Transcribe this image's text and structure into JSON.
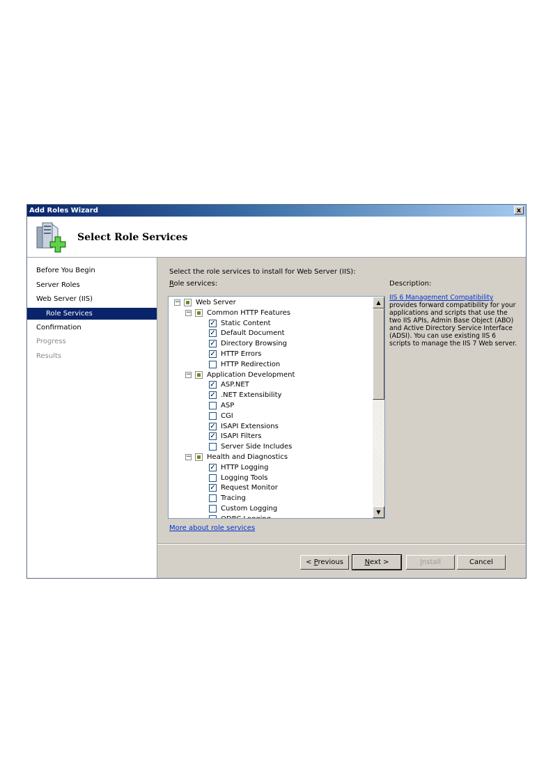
{
  "window": {
    "title": "Add Roles Wizard",
    "close_label": "x",
    "header_title": "Select Role Services"
  },
  "nav": {
    "items": [
      {
        "label": "Before You Begin",
        "state": "normal"
      },
      {
        "label": "Server Roles",
        "state": "normal"
      },
      {
        "label": "Web Server (IIS)",
        "state": "normal"
      },
      {
        "label": "Role Services",
        "state": "active"
      },
      {
        "label": "Confirmation",
        "state": "normal"
      },
      {
        "label": "Progress",
        "state": "disabled"
      },
      {
        "label": "Results",
        "state": "disabled"
      }
    ]
  },
  "content": {
    "prompt": "Select the role services to install for Web Server (IIS):",
    "role_services_label_first": "R",
    "role_services_label_rest": "ole services:",
    "description_label": "Description:",
    "description_link": "IIS 6 Management Compatibility",
    "description_text": "provides forward compatibility for your applications and scripts that use the two IIS APIs, Admin Base Object (ABO) and Active Directory Service Interface (ADSI). You can use existing IIS 6 scripts to manage the IIS 7 Web server.",
    "more_link": "More about role services"
  },
  "tree": [
    {
      "label": "Web Server",
      "level": 0,
      "group": true,
      "state": "partial"
    },
    {
      "label": "Common HTTP Features",
      "level": 1,
      "group": true,
      "state": "partial"
    },
    {
      "label": "Static Content",
      "level": 2,
      "state": "checked"
    },
    {
      "label": "Default Document",
      "level": 2,
      "state": "checked"
    },
    {
      "label": "Directory Browsing",
      "level": 2,
      "state": "checked"
    },
    {
      "label": "HTTP Errors",
      "level": 2,
      "state": "checked"
    },
    {
      "label": "HTTP Redirection",
      "level": 2,
      "state": "unchecked"
    },
    {
      "label": "Application Development",
      "level": 1,
      "group": true,
      "state": "partial"
    },
    {
      "label": "ASP.NET",
      "level": 2,
      "state": "checked"
    },
    {
      "label": ".NET Extensibility",
      "level": 2,
      "state": "checked"
    },
    {
      "label": "ASP",
      "level": 2,
      "state": "unchecked"
    },
    {
      "label": "CGI",
      "level": 2,
      "state": "unchecked"
    },
    {
      "label": "ISAPI Extensions",
      "level": 2,
      "state": "checked"
    },
    {
      "label": "ISAPI Filters",
      "level": 2,
      "state": "checked"
    },
    {
      "label": "Server Side Includes",
      "level": 2,
      "state": "unchecked"
    },
    {
      "label": "Health and Diagnostics",
      "level": 1,
      "group": true,
      "state": "partial"
    },
    {
      "label": "HTTP Logging",
      "level": 2,
      "state": "checked"
    },
    {
      "label": "Logging Tools",
      "level": 2,
      "state": "unchecked"
    },
    {
      "label": "Request Monitor",
      "level": 2,
      "state": "checked"
    },
    {
      "label": "Tracing",
      "level": 2,
      "state": "unchecked"
    },
    {
      "label": "Custom Logging",
      "level": 2,
      "state": "unchecked"
    },
    {
      "label": "ODBC Logging",
      "level": 2,
      "state": "unchecked"
    }
  ],
  "buttons": {
    "previous_pre": "< ",
    "previous_accel": "P",
    "previous_rest": "revious",
    "next_accel": "N",
    "next_rest": "ext >",
    "install_accel": "I",
    "install_rest": "nstall",
    "cancel": "Cancel"
  },
  "icons": {
    "header": "server-add-icon",
    "scroll_up": "scroll-up-arrow-icon",
    "scroll_down": "scroll-down-arrow-icon"
  },
  "colors": {
    "active_nav": "#0a246a",
    "link": "#0033cc"
  }
}
